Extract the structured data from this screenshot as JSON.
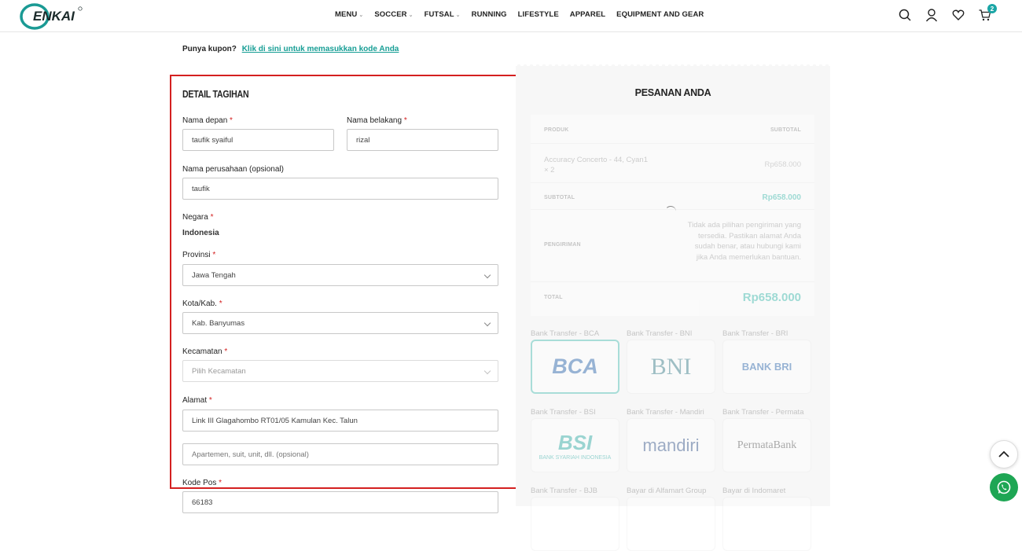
{
  "header": {
    "logo_text": "ENKAI",
    "nav": [
      {
        "label": "MENU",
        "caret": true
      },
      {
        "label": "SOCCER",
        "caret": true
      },
      {
        "label": "FUTSAL",
        "caret": true
      },
      {
        "label": "RUNNING",
        "caret": false
      },
      {
        "label": "LIFESTYLE",
        "caret": false
      },
      {
        "label": "APPAREL",
        "caret": false
      },
      {
        "label": "EQUIPMENT AND GEAR",
        "caret": false
      }
    ],
    "cart_count": "2",
    "icons": [
      "search-icon",
      "user-icon",
      "heart-icon",
      "cart-icon"
    ]
  },
  "coupon": {
    "label": "Punya kupon?",
    "link": "Klik di sini untuk memasukkan kode Anda"
  },
  "billing": {
    "title": "DETAIL TAGIHAN",
    "first_name_label": "Nama depan",
    "first_name": "taufik syaiful",
    "last_name_label": "Nama belakang",
    "last_name": "rizal",
    "company_label": "Nama perusahaan (opsional)",
    "company": "taufik",
    "country_label": "Negara",
    "country": "Indonesia",
    "province_label": "Provinsi",
    "province": "Jawa Tengah",
    "city_label": "Kota/Kab.",
    "city": "Kab. Banyumas",
    "district_label": "Kecamatan",
    "district_placeholder": "Pilih Kecamatan",
    "address_label": "Alamat",
    "address_1": "Link III Glagahombo RT01/05 Kamulan Kec. Talun",
    "address_2_placeholder": "Apartemen, suit, unit, dll. (opsional)",
    "postcode_label": "Kode Pos",
    "postcode": "66183",
    "required_mark": "*"
  },
  "order": {
    "title": "PESANAN ANDA",
    "col_product": "PRODUK",
    "col_subtotal": "SUBTOTAL",
    "item_name": "Accuracy Concerto - 44, Cyan1",
    "item_qty": "× 2",
    "item_price": "Rp658.000",
    "subtotal_label": "SUBTOTAL",
    "subtotal": "Rp658.000",
    "shipping_label": "PENGIRIMAN",
    "shipping_text": "Tidak ada pilihan pengiriman yang tersedia. Pastikan alamat Anda sudah benar, atau hubungi kami jika Anda memerlukan bantuan.",
    "total_label": "TOTAL",
    "total": "Rp658.000"
  },
  "payments": [
    {
      "label": "Bank Transfer - BCA",
      "logo": "BCA"
    },
    {
      "label": "Bank Transfer - BNI",
      "logo": "BNI"
    },
    {
      "label": "Bank Transfer - BRI",
      "logo": "BANK BRI"
    },
    {
      "label": "Bank Transfer - BSI",
      "logo": "BSI",
      "sub": "BANK SYARIAH INDONESIA"
    },
    {
      "label": "Bank Transfer - Mandiri",
      "logo": "mandiri"
    },
    {
      "label": "Bank Transfer - Permata",
      "logo": "PermataBank"
    },
    {
      "label": "Bank Transfer - BJB"
    },
    {
      "label": "Bayar di Alfamart Group"
    },
    {
      "label": "Bayar di Indomaret"
    }
  ],
  "colors": {
    "accent": "#179e95",
    "required": "#d42020",
    "highlight_border": "#d42020",
    "whatsapp": "#1ea654"
  }
}
